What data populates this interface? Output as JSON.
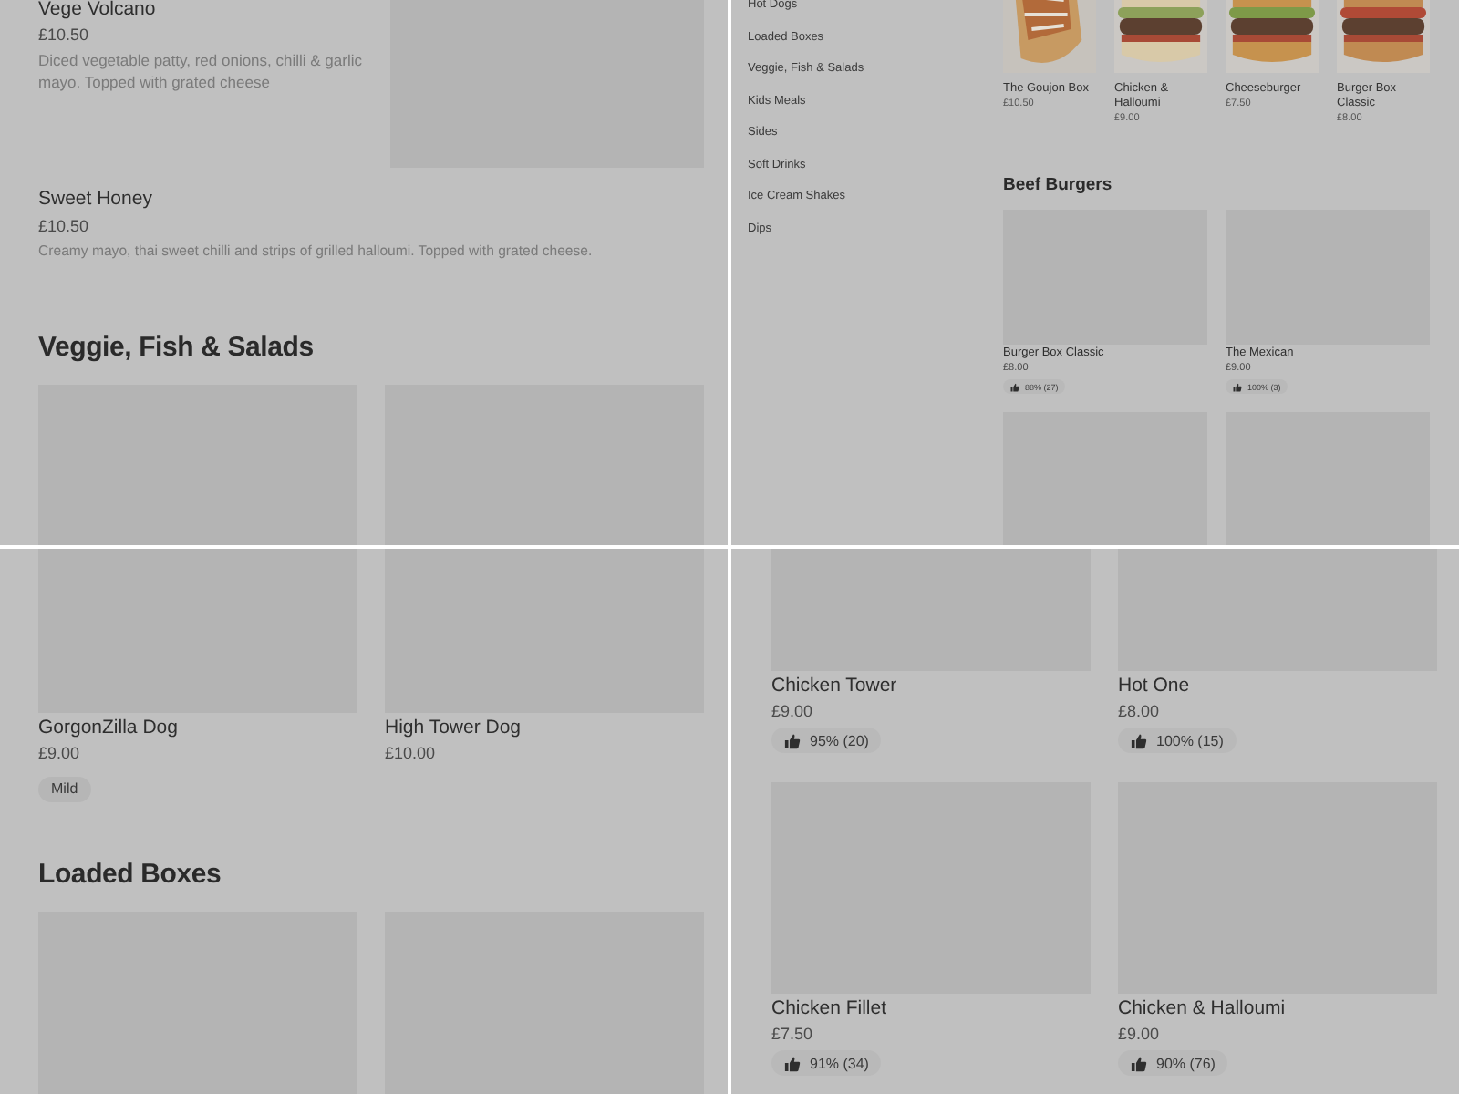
{
  "panels": [
    {
      "kind": "menu_list",
      "items": [
        {
          "kind": "with_image",
          "name": "Vege Volcano",
          "price": "£10.50",
          "description": "Diced vegetable patty, red onions, chilli & garlic mayo. Topped with grated cheese"
        },
        {
          "kind": "text_only",
          "name": "Sweet Honey",
          "price": "£10.50",
          "description": "Creamy mayo, thai sweet chilli and strips of grilled halloumi. Topped with grated cheese."
        }
      ],
      "section_title": "Veggie, Fish & Salads"
    },
    {
      "kind": "category_browse",
      "categories": [
        "Hot Dogs",
        "Loaded Boxes",
        "Veggie, Fish & Salads",
        "Kids Meals",
        "Sides",
        "Soft Drinks",
        "Ice Cream Shakes",
        "Dips"
      ],
      "featured": [
        {
          "name": "The Goujon Box",
          "price": "£10.50"
        },
        {
          "name": "Chicken & Halloumi",
          "price": "£9.00"
        },
        {
          "name": "Cheeseburger",
          "price": "£7.50"
        },
        {
          "name": "Burger Box Classic",
          "price": "£8.00"
        }
      ],
      "section_title": "Beef Burgers",
      "cards": [
        {
          "name": "Burger Box Classic",
          "price": "£8.00",
          "rating": "88% (27)"
        },
        {
          "name": "The Mexican",
          "price": "£9.00",
          "rating": "100% (3)"
        }
      ]
    },
    {
      "kind": "card_grid",
      "cards": [
        {
          "name": "GorgonZilla Dog",
          "price": "£9.00",
          "tag": "Mild"
        },
        {
          "name": "High Tower Dog",
          "price": "£10.00"
        }
      ],
      "section_title": "Loaded Boxes"
    },
    {
      "kind": "card_grid_ratings",
      "cards": [
        {
          "name": "Chicken Tower",
          "price": "£9.00",
          "rating": "95% (20)"
        },
        {
          "name": "Hot One",
          "price": "£8.00",
          "rating": "100% (15)"
        },
        {
          "name": "Chicken Fillet",
          "price": "£7.50",
          "rating": "91% (34)"
        },
        {
          "name": "Chicken & Halloumi",
          "price": "£9.00",
          "rating": "90% (76)"
        }
      ]
    }
  ]
}
